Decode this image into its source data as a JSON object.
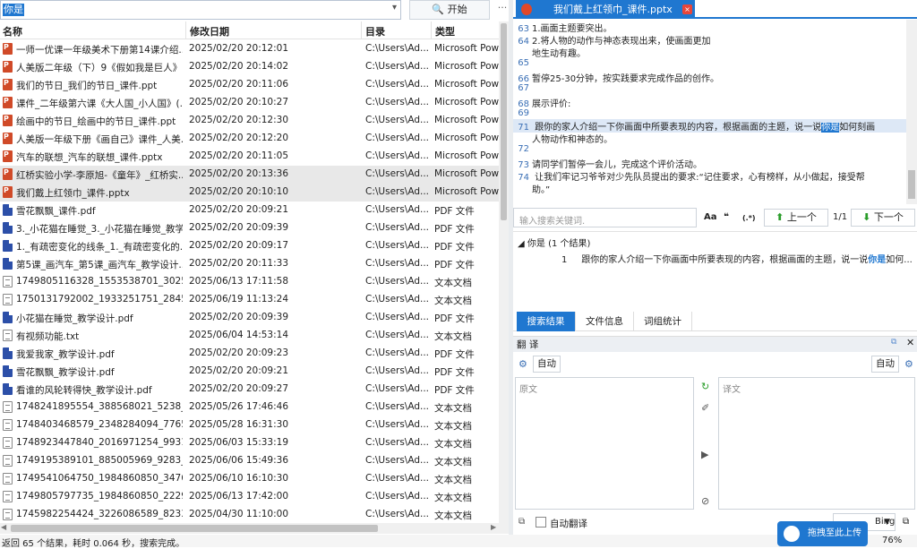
{
  "search": {
    "query": "你是",
    "start_label": "开始",
    "more_label": "···"
  },
  "columns": {
    "name": "名称",
    "modified": "修改日期",
    "dir": "目录",
    "type": "类型"
  },
  "files": [
    {
      "icon": "ppt",
      "name": "一师一优课一年级美术下册第14课介绍...",
      "date": "2025/02/20 20:12:01",
      "dir": "C:\\Users\\Ad...",
      "type": "Microsoft Powe"
    },
    {
      "icon": "ppt",
      "name": "人美版二年级（下）9《假如我是巨人》...",
      "date": "2025/02/20 20:14:02",
      "dir": "C:\\Users\\Ad...",
      "type": "Microsoft Powe"
    },
    {
      "icon": "ppt",
      "name": "我们的节日_我们的节日_课件.ppt",
      "date": "2025/02/20 20:11:06",
      "dir": "C:\\Users\\Ad...",
      "type": "Microsoft Powe"
    },
    {
      "icon": "ppt",
      "name": "课件_二年级第六课《大人国_小人国》(...",
      "date": "2025/02/20 20:10:27",
      "dir": "C:\\Users\\Ad...",
      "type": "Microsoft Powe"
    },
    {
      "icon": "ppt",
      "name": "绘画中的节日_绘画中的节日_课件.ppt",
      "date": "2025/02/20 20:12:30",
      "dir": "C:\\Users\\Ad...",
      "type": "Microsoft Powe"
    },
    {
      "icon": "ppt",
      "name": "人美版一年级下册《画自己》课件_人美...",
      "date": "2025/02/20 20:12:20",
      "dir": "C:\\Users\\Ad...",
      "type": "Microsoft Powe"
    },
    {
      "icon": "ppt",
      "name": "汽车的联想_汽车的联想_课件.pptx",
      "date": "2025/02/20 20:11:05",
      "dir": "C:\\Users\\Ad...",
      "type": "Microsoft Powe"
    },
    {
      "icon": "ppt",
      "name": "红桥实验小学-李原旭-《童年》_红桥实...",
      "date": "2025/02/20 20:13:36",
      "dir": "C:\\Users\\Ad...",
      "type": "Microsoft Powe",
      "sel": true
    },
    {
      "icon": "ppt",
      "name": "我们戴上红领巾_课件.pptx",
      "date": "2025/02/20 20:10:10",
      "dir": "C:\\Users\\Ad...",
      "type": "Microsoft Powe",
      "sel": true
    },
    {
      "icon": "pdf",
      "name": "雪花飘飘_课件.pdf",
      "date": "2025/02/20 20:09:21",
      "dir": "C:\\Users\\Ad...",
      "type": "PDF 文件"
    },
    {
      "icon": "pdf",
      "name": "3._小花猫在睡觉_3._小花猫在睡觉_教学...",
      "date": "2025/02/20 20:09:39",
      "dir": "C:\\Users\\Ad...",
      "type": "PDF 文件"
    },
    {
      "icon": "pdf",
      "name": "1._有疏密变化的线条_1._有疏密变化的...",
      "date": "2025/02/20 20:09:17",
      "dir": "C:\\Users\\Ad...",
      "type": "PDF 文件"
    },
    {
      "icon": "pdf",
      "name": "第5课_画汽车_第5课_画汽车_教学设计....",
      "date": "2025/02/20 20:11:33",
      "dir": "C:\\Users\\Ad...",
      "type": "PDF 文件"
    },
    {
      "icon": "txt",
      "name": "1749805116328_1553538701_3025...",
      "date": "2025/06/13 17:11:58",
      "dir": "C:\\Users\\Ad...",
      "type": "文本文档"
    },
    {
      "icon": "txt",
      "name": "1750131792002_1933251751_2845...",
      "date": "2025/06/19 11:13:24",
      "dir": "C:\\Users\\Ad...",
      "type": "文本文档"
    },
    {
      "icon": "pdf",
      "name": "小花猫在睡觉_教学设计.pdf",
      "date": "2025/02/20 20:09:39",
      "dir": "C:\\Users\\Ad...",
      "type": "PDF 文件"
    },
    {
      "icon": "txt",
      "name": "有视频功能.txt",
      "date": "2025/06/04 14:53:14",
      "dir": "C:\\Users\\Ad...",
      "type": "文本文档"
    },
    {
      "icon": "pdf",
      "name": "我爱我家_教学设计.pdf",
      "date": "2025/02/20 20:09:23",
      "dir": "C:\\Users\\Ad...",
      "type": "PDF 文件"
    },
    {
      "icon": "pdf",
      "name": "雪花飘飘_教学设计.pdf",
      "date": "2025/02/20 20:09:21",
      "dir": "C:\\Users\\Ad...",
      "type": "PDF 文件"
    },
    {
      "icon": "pdf",
      "name": "看谁的风轮转得快_教学设计.pdf",
      "date": "2025/02/20 20:09:27",
      "dir": "C:\\Users\\Ad...",
      "type": "PDF 文件"
    },
    {
      "icon": "txt",
      "name": "1748241895554_388568021_5238_...",
      "date": "2025/05/26 17:46:46",
      "dir": "C:\\Users\\Ad...",
      "type": "文本文档"
    },
    {
      "icon": "txt",
      "name": "1748403468579_2348284094_7765...",
      "date": "2025/05/28 16:31:30",
      "dir": "C:\\Users\\Ad...",
      "type": "文本文档"
    },
    {
      "icon": "txt",
      "name": "1748923447840_2016971254_9931...",
      "date": "2025/06/03 15:33:19",
      "dir": "C:\\Users\\Ad...",
      "type": "文本文档"
    },
    {
      "icon": "txt",
      "name": "1749195389101_885005969_9283_...",
      "date": "2025/06/06 15:49:36",
      "dir": "C:\\Users\\Ad...",
      "type": "文本文档"
    },
    {
      "icon": "txt",
      "name": "1749541064750_1984860850_3476...",
      "date": "2025/06/10 16:10:30",
      "dir": "C:\\Users\\Ad...",
      "type": "文本文档"
    },
    {
      "icon": "txt",
      "name": "1749805797735_1984860850_2229...",
      "date": "2025/06/13 17:42:00",
      "dir": "C:\\Users\\Ad...",
      "type": "文本文档"
    },
    {
      "icon": "txt",
      "name": "1745982254424_3226086589_8233...",
      "date": "2025/04/30 11:10:00",
      "dir": "C:\\Users\\Ad...",
      "type": "文本文档"
    }
  ],
  "status": {
    "text": "返回 65 个结果，耗时 0.064 秒，搜索完成。",
    "zoom": "76%"
  },
  "doc_tab": {
    "title": "我们戴上红领巾_课件.pptx",
    "close": "×"
  },
  "preview": {
    "l63": "1.画面主题要突出。",
    "l64": "2.将人物的动作与神态表现出来，使画面更加",
    "l66": "地生动有趣。",
    "l67": "暂停25-30分钟，按实践要求完成作品的创作。",
    "l69": "展示评价:",
    "l71a": "        跟你的家人介绍一下你画面中所要表现的内容，根据画面的主题，说一说",
    "l71hit": "你是",
    "l71b": "如何刻画",
    "l71c": "人物动作和神态的。",
    "l73": "请同学们暂停一会儿，完成这个评价活动。",
    "l74a": "    让我们牢记习爷爷对少先队员提出的要求:“记住要求，心有榜样，从小做起，接受帮",
    "l74b": "助。”"
  },
  "line_numbers": [
    "63",
    "64",
    "65",
    "66",
    "67",
    "68",
    "69",
    "70",
    "71",
    "72",
    "73",
    "74"
  ],
  "find": {
    "placeholder": "输入搜索关键词.",
    "opt_aa": "Aa",
    "opt_quote": "❝",
    "opt_regex": "(.*)",
    "prev": "上一个",
    "count": "1/1",
    "next": "下一个"
  },
  "result": {
    "group": "你是 (1 个结果)",
    "num": "1",
    "text_a": "跟你的家人介绍一下你画面中所要表现的内容，根据画面的主题，说一说",
    "text_hit": "你是",
    "text_b": "如何..."
  },
  "bottom_tabs": [
    "搜索结果",
    "文件信息",
    "词组统计"
  ],
  "translate": {
    "title": "翻 译",
    "auto_left": "自动",
    "auto_right": "自动",
    "source_ph": "原文",
    "target_ph": "译文",
    "auto_translate": "自动翻译",
    "engine": "Bing",
    "drag": "拖拽至此上传"
  }
}
